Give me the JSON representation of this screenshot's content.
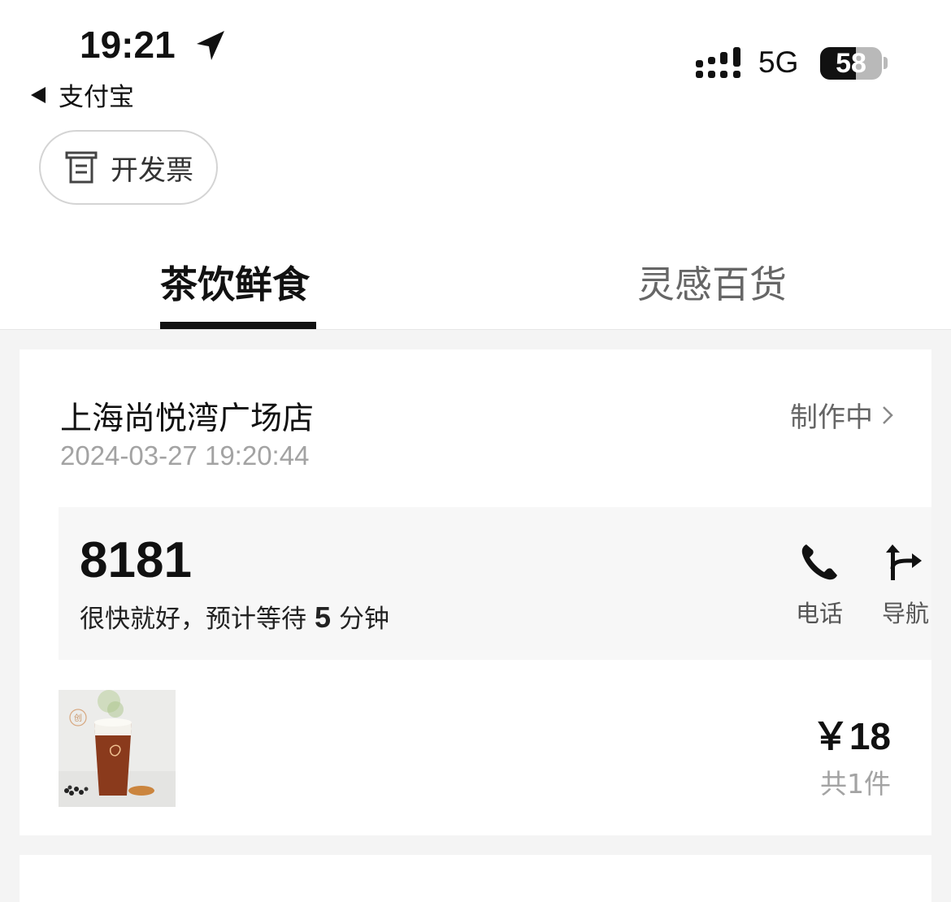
{
  "status_bar": {
    "time": "19:21",
    "back_app": "支付宝",
    "network": "5G",
    "battery": "58",
    "battery_level": 0.58
  },
  "invoice": {
    "label": "开发票"
  },
  "tabs": [
    {
      "label": "茶饮鲜食",
      "active": true
    },
    {
      "label": "灵感百货",
      "active": false
    }
  ],
  "order": {
    "store": "上海尚悦湾广场店",
    "time": "2024-03-27 19:20:44",
    "status": "制作中",
    "pickup_number": "8181",
    "wait_prefix": "很快就好，预计等待",
    "wait_minutes": "5",
    "wait_suffix": "分钟",
    "actions": {
      "call": "电话",
      "navigate": "导航"
    },
    "price": "￥18",
    "count": "共1件",
    "thumb_badge": "创"
  },
  "colors": {
    "accent": "#111111",
    "muted": "#a3a3a3",
    "background": "#f4f4f4"
  }
}
